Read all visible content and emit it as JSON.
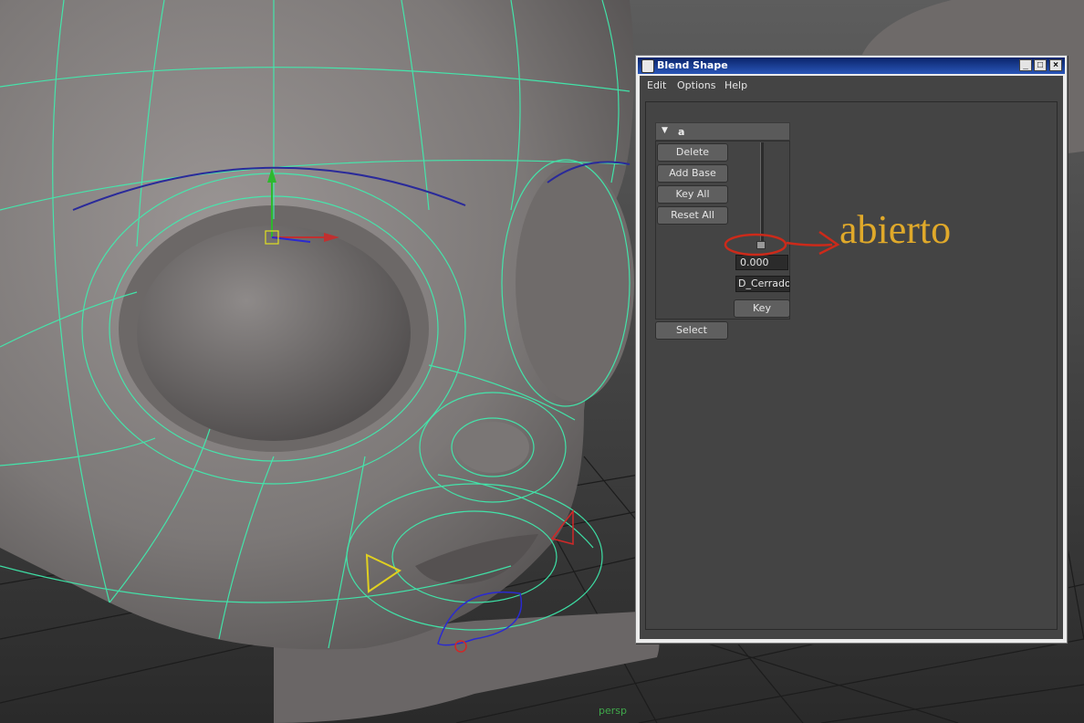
{
  "window": {
    "title": "Blend Shape",
    "minimize_glyph": "_",
    "maximize_glyph": "□",
    "close_glyph": "×"
  },
  "menubar": {
    "edit": "Edit",
    "options": "Options",
    "help": "Help"
  },
  "blend_node": {
    "name": "a",
    "collapse_glyph": "▼",
    "buttons": {
      "delete": "Delete",
      "add_base": "Add Base",
      "key_all": "Key All",
      "reset_all": "Reset All",
      "select": "Select"
    },
    "target": {
      "weight_value": "0.000",
      "name": "D_Cerrado",
      "key_button": "Key",
      "weight": 0.0
    }
  },
  "viewport": {
    "camera_label": "persp"
  },
  "annotation": {
    "text": "abierto",
    "color": "#e0a92a",
    "marker_color": "#cc2a1a"
  },
  "colors": {
    "wireframe": "#3ef0b0",
    "title_bar": "#0a246a",
    "panel": "#444444"
  }
}
